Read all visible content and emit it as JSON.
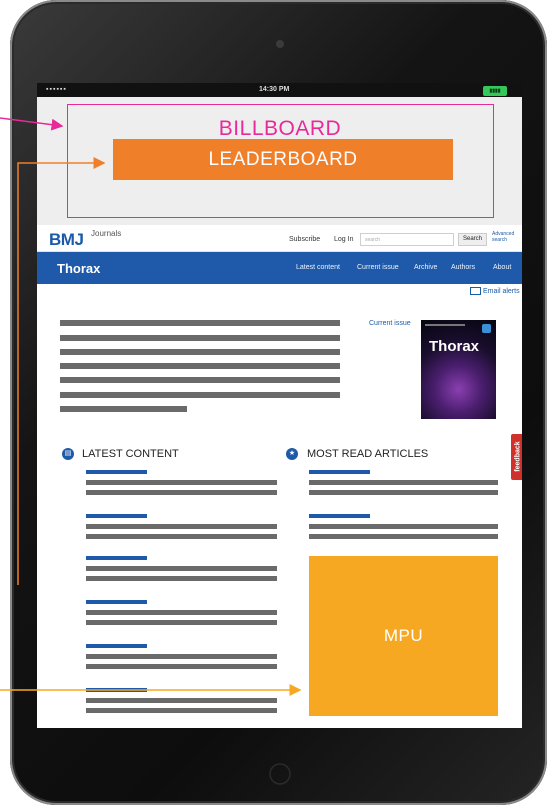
{
  "status_bar": {
    "signal": "▪▪▪▪▪▪",
    "time": "14:30 PM",
    "battery": "▮▮▮▮"
  },
  "ads": {
    "billboard_label": "BILLBOARD",
    "leaderboard_label": "LEADERBOARD",
    "mpu_label": "MPU"
  },
  "journal_header": {
    "logo": "BMJ",
    "logo_sub": "Journals",
    "subscribe": "Subscribe",
    "login": "Log In",
    "search_placeholder": "search",
    "search_button": "Search",
    "advanced_search": "Advanced search"
  },
  "navbar": {
    "title": "Thorax",
    "items": [
      "Latest content",
      "Current issue",
      "Archive",
      "Authors",
      "About"
    ]
  },
  "email_alerts": "Email alerts",
  "current_issue": {
    "label": "Current issue",
    "cover_title": "Thorax"
  },
  "sections": {
    "latest_content": "LATEST CONTENT",
    "most_read": "MOST READ ARTICLES"
  },
  "feedback": "feedback",
  "colors": {
    "billboard": "#e8299a",
    "leaderboard": "#f07f2a",
    "mpu": "#f7a823",
    "nav": "#1e5aa9",
    "placeholder_bar": "#6a6a6a"
  }
}
